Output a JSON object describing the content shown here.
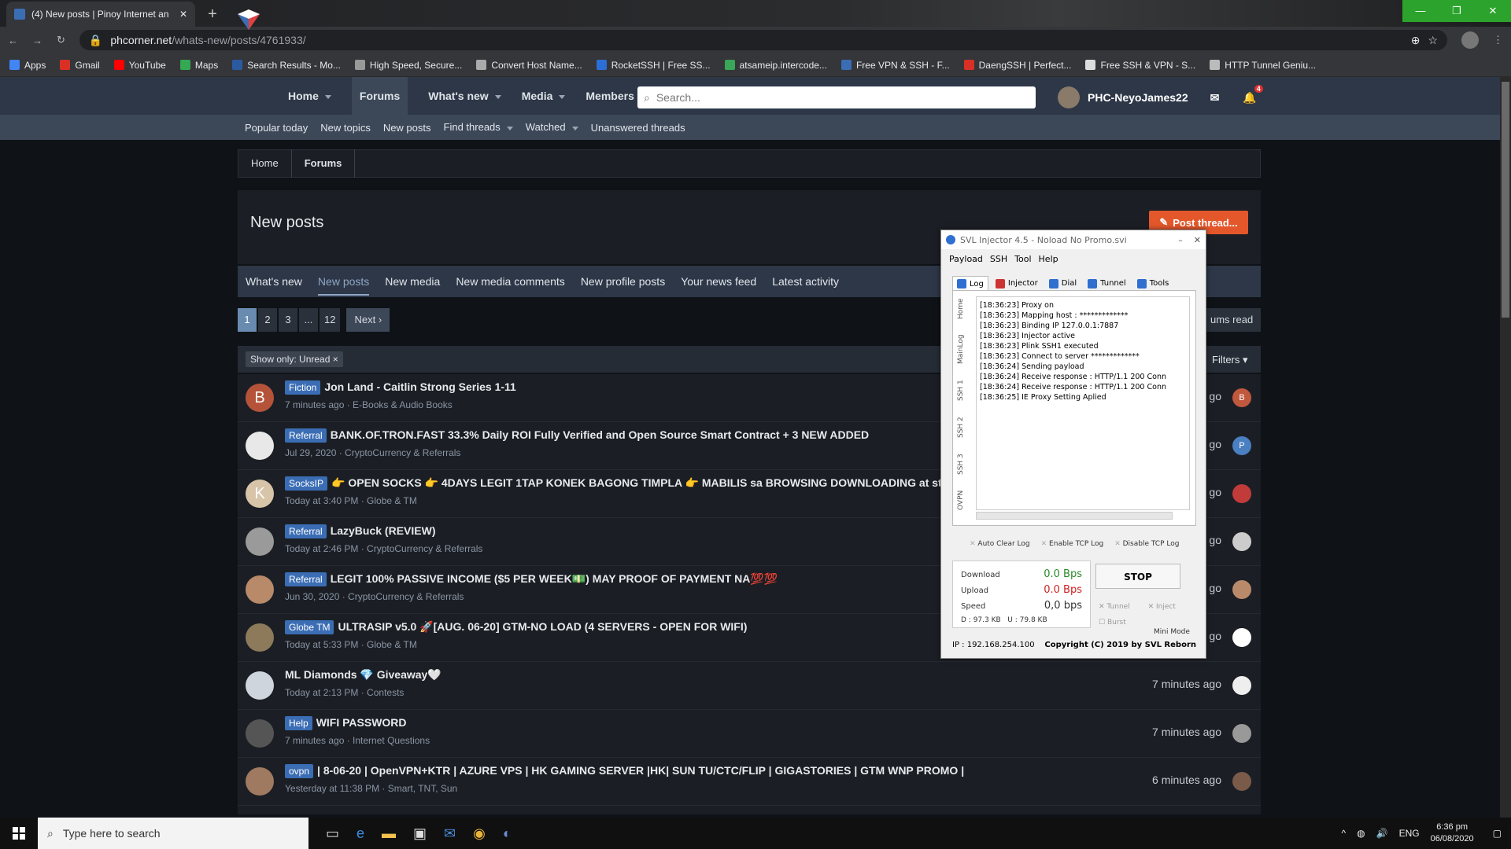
{
  "browser": {
    "tab_title": "(4) New posts | Pinoy Internet an",
    "url_host": "phcorner.net",
    "url_path": "/whats-new/posts/4761933/",
    "bookmarks": [
      {
        "label": "Apps",
        "color": "#4285f4"
      },
      {
        "label": "Gmail",
        "color": "#d93025"
      },
      {
        "label": "YouTube",
        "color": "#ff0000"
      },
      {
        "label": "Maps",
        "color": "#34a853"
      },
      {
        "label": "Search Results - Mo...",
        "color": "#2c5aa0"
      },
      {
        "label": "High Speed, Secure...",
        "color": "#999999"
      },
      {
        "label": "Convert Host Name...",
        "color": "#aaaaaa"
      },
      {
        "label": "RocketSSH | Free SS...",
        "color": "#2b6fd6"
      },
      {
        "label": "atsameip.intercode...",
        "color": "#3aa657"
      },
      {
        "label": "Free VPN & SSH - F...",
        "color": "#3b6db4"
      },
      {
        "label": "DaengSSH | Perfect...",
        "color": "#d93025"
      },
      {
        "label": "Free SSH & VPN - S...",
        "color": "#dddddd"
      },
      {
        "label": "HTTP Tunnel Geniu...",
        "color": "#bbbbbb"
      }
    ]
  },
  "site": {
    "nav": [
      {
        "label": "Home",
        "caret": true
      },
      {
        "label": "Forums",
        "caret": false
      },
      {
        "label": "What's new",
        "caret": true
      },
      {
        "label": "Media",
        "caret": true
      },
      {
        "label": "Members",
        "caret": true
      }
    ],
    "search_placeholder": "Search...",
    "username": "PHC-NeyoJames22",
    "alert_count": "4",
    "subnav": [
      "Popular today",
      "New topics",
      "New posts",
      "Find threads",
      "Watched",
      "Unanswered threads"
    ],
    "breadcrumb": [
      "Home",
      "Forums"
    ],
    "page_title": "New posts",
    "post_button": "Post thread...",
    "tabs": [
      "What's new",
      "New posts",
      "New media",
      "New media comments",
      "New profile posts",
      "Your news feed",
      "Latest activity"
    ],
    "pager": [
      "1",
      "2",
      "3",
      "...",
      "12"
    ],
    "pager_next": "Next",
    "mark_read": "ums read",
    "filter_chip": "Show only: Unread",
    "filters": "Filters",
    "threads": [
      {
        "prefix": "Fiction",
        "title": "Jon Land - Caitlin Strong Series 1-11",
        "meta": "7 minutes ago · E-Books & Audio Books",
        "time": "go",
        "avatar": "B",
        "avcolor": "#b5533a",
        "racolor": "#c0583e",
        "ra": "B"
      },
      {
        "prefix": "Referral",
        "title": "BANK.OF.TRON.FAST 33.3% Daily ROI Fully Verified and Open Source Smart Contract + 3 NEW ADDED",
        "meta": "Jul 29, 2020 · CryptoCurrency & Referrals",
        "time": "go",
        "avatar": "",
        "avcolor": "#e8e8e8",
        "racolor": "#4a7fc1",
        "ra": "P"
      },
      {
        "prefix": "SocksIP",
        "title": "👉 OPEN SOCKS 👉 4DAYS LEGIT 1TAP KONEK BAGONG TIMPLA 👉 MABILIS sa BROWSING DOWNLOADING at str",
        "meta": "Today at 3:40 PM · Globe & TM",
        "time": "go",
        "avatar": "K",
        "avcolor": "#d8c4a8",
        "racolor": "#c23b3b",
        "ra": ""
      },
      {
        "prefix": "Referral",
        "title": "LazyBuck (REVIEW)",
        "meta": "Today at 2:46 PM · CryptoCurrency & Referrals",
        "time": "go",
        "avatar": "",
        "avcolor": "#9a9a9a",
        "racolor": "#cccccc",
        "ra": ""
      },
      {
        "prefix": "Referral",
        "title": "LEGIT 100% PASSIVE INCOME ($5 PER WEEK💵) MAY PROOF OF PAYMENT NA💯💯",
        "meta": "Jun 30, 2020 · CryptoCurrency & Referrals",
        "time": "go",
        "avatar": "",
        "avcolor": "#b98a6a",
        "racolor": "#b98a6a",
        "ra": ""
      },
      {
        "prefix": "Globe TM",
        "title": "ULTRASIP v5.0 🚀[AUG. 06-20] GTM-NO LOAD (4 SERVERS - OPEN FOR WIFI)",
        "meta": "Today at 5:33 PM · Globe & TM",
        "time": "go",
        "avatar": "",
        "avcolor": "#8c7a5a",
        "racolor": "#ffffff",
        "ra": ""
      },
      {
        "prefix": "",
        "title": "ML Diamonds 💎 Giveaway🤍",
        "meta": "Today at 2:13 PM · Contests",
        "time": "7 minutes ago",
        "avatar": "",
        "avcolor": "#cfd5dd",
        "racolor": "#eeeeee",
        "ra": ""
      },
      {
        "prefix": "Help",
        "title": "WIFI PASSWORD",
        "meta": "7 minutes ago · Internet Questions",
        "time": "7 minutes ago",
        "avatar": "",
        "avcolor": "#555555",
        "racolor": "#999999",
        "ra": ""
      },
      {
        "prefix": "ovpn",
        "title": "| 8-06-20 | OpenVPN+KTR | AZURE VPS | HK GAMING SERVER |HK| SUN TU/CTC/FLIP | GIGASTORIES | GTM WNP PROMO |",
        "meta": "Yesterday at 11:38 PM · Smart, TNT, Sun",
        "time": "6 minutes ago",
        "avatar": "",
        "avcolor": "#a07a60",
        "racolor": "#7a5a48",
        "ra": ""
      }
    ]
  },
  "svl": {
    "title": "SVL Injector 4.5 - Noload No Promo.svi",
    "menu": [
      "Payload",
      "SSH",
      "Tool",
      "Help"
    ],
    "tabs": [
      {
        "label": "Log",
        "color": "#2f6fd0"
      },
      {
        "label": "Injector",
        "color": "#cc3333"
      },
      {
        "label": "Dial",
        "color": "#2f6fd0"
      },
      {
        "label": "Tunnel",
        "color": "#2f6fd0"
      },
      {
        "label": "Tools",
        "color": "#2f6fd0"
      }
    ],
    "side_tabs": [
      "Home",
      "MainLog",
      "SSH 1",
      "SSH 2",
      "SSH 3",
      "OVPN"
    ],
    "log": [
      "[18:36:23] Proxy on",
      "[18:36:23] Mapping host : *************",
      "[18:36:23] Binding IP 127.0.0.1:7887",
      "[18:36:23] Injector active",
      "[18:36:23] Plink SSH1 executed",
      "[18:36:23] Connect to server *************",
      "[18:36:24] Sending payload",
      "[18:36:24] Receive response : HTTP/1.1 200 Conn",
      "[18:36:24] Receive response : HTTP/1.1 200 Conn",
      "[18:36:25] IE Proxy Setting Aplied"
    ],
    "checks": [
      "Auto Clear Log",
      "Enable TCP Log",
      "Disable TCP Log"
    ],
    "download_label": "Download",
    "download": "0.0 Bps",
    "upload_label": "Upload",
    "upload": "0.0 Bps",
    "speed_label": "Speed",
    "speed": "0,0 bps",
    "d_label": "D :",
    "d_val": "97.3 KB",
    "u_label": "U :",
    "u_val": "79.8 KB",
    "stop": "STOP",
    "opt_tunnel": "Tunnel",
    "opt_inject": "Inject",
    "opt_burst": "Burst",
    "mini": "Mini Mode",
    "ip": "IP : 192.168.254.100",
    "copyright": "Copyright (C) 2019 by SVL Reborn"
  },
  "taskbar": {
    "search": "Type here to search",
    "lang": "ENG",
    "time": "6:36 pm",
    "date": "06/08/2020"
  }
}
